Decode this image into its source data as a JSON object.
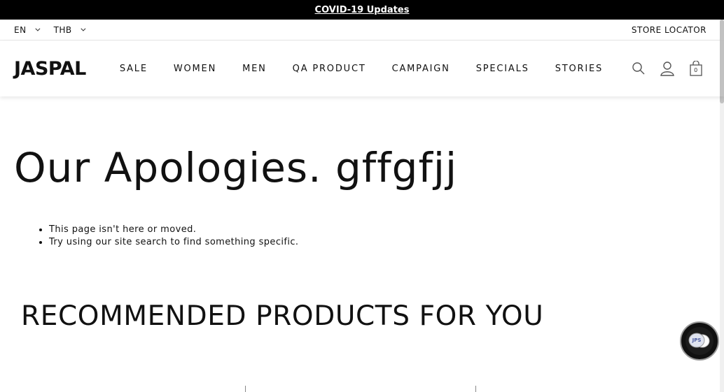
{
  "announcement": {
    "text": "COVID-19 Updates"
  },
  "utility": {
    "language": "EN",
    "currency": "THB",
    "store_locator": "STORE LOCATOR"
  },
  "header": {
    "logo": "JASPAL",
    "nav": [
      "SALE",
      "WOMEN",
      "MEN",
      "QA PRODUCT",
      "CAMPAIGN",
      "SPECIALS",
      "STORIES"
    ],
    "cart_count": "0",
    "icons": [
      "search-icon",
      "account-icon",
      "cart-icon"
    ]
  },
  "main": {
    "title": "Our Apologies. gffgfjj",
    "tips": [
      "This page isn't here or moved.",
      "Try using our site search to find something specific."
    ],
    "recommended_heading": "RECOMMENDED PRODUCTS FOR YOU"
  },
  "chat": {
    "label": "JPS"
  }
}
